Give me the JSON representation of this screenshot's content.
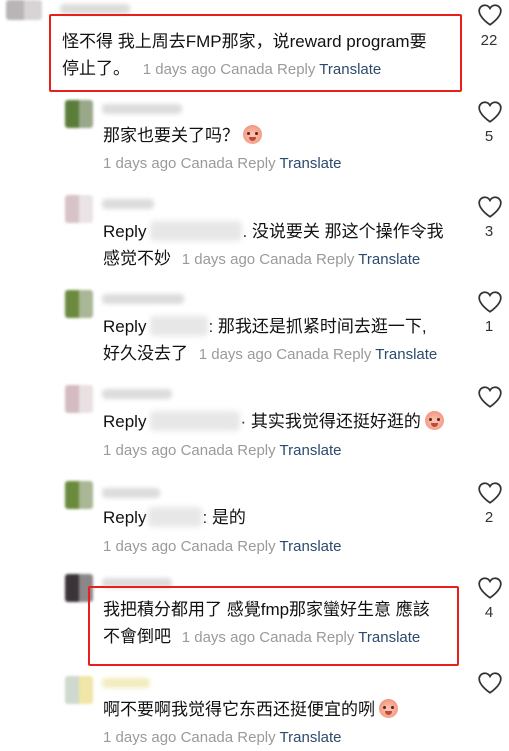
{
  "colors": {
    "highlight": "#e8201c",
    "translate_link": "#2d4a6e",
    "meta_gray": "#9a9a9a"
  },
  "comments": [
    {
      "text": "怪不得 我上周去FMP那家，说reward program要",
      "text2": "停止了。",
      "time": "1 days ago",
      "location": "Canada",
      "reply_label": "Reply",
      "translate_label": "Translate",
      "likes": "22",
      "highlighted": true,
      "avatar_colors": [
        "#b9b4b6",
        "#d8d4d6"
      ]
    },
    {
      "text": "那家也要关了吗？",
      "emoji": "crying-face-emoji",
      "time": "1 days ago",
      "location": "Canada",
      "reply_label": "Reply",
      "translate_label": "Translate",
      "likes": "5",
      "avatar_colors": [
        "#5b7d3a",
        "#9aa88a"
      ]
    },
    {
      "prefix": "Reply",
      "text": ". 没说要关 那这个操作令我",
      "text2": "感觉不妙",
      "time": "1 days ago",
      "location": "Canada",
      "reply_label": "Reply",
      "translate_label": "Translate",
      "likes": "3",
      "avatar_colors": [
        "#d8c3c7",
        "#ebe3e5"
      ]
    },
    {
      "prefix": "Reply",
      "text": ": 那我还是抓紧时间去逛一下,",
      "text2": "好久没去了",
      "time": "1 days ago",
      "location": "Canada",
      "reply_label": "Reply",
      "translate_label": "Translate",
      "likes": "1",
      "avatar_colors": [
        "#6b8a3e",
        "#a9b795"
      ]
    },
    {
      "prefix": "Reply",
      "text": "· 其实我觉得还挺好逛的",
      "emoji": "crying-face-emoji",
      "time": "1 days ago",
      "location": "Canada",
      "reply_label": "Reply",
      "translate_label": "Translate",
      "likes": "",
      "avatar_colors": [
        "#d4bcc1",
        "#e9e0e2"
      ]
    },
    {
      "prefix": "Reply",
      "text": ": 是的",
      "time": "1 days ago",
      "location": "Canada",
      "reply_label": "Reply",
      "translate_label": "Translate",
      "likes": "2",
      "avatar_colors": [
        "#6b8a3e",
        "#a9b795"
      ]
    },
    {
      "text": "我把積分都用了 感覺fmp那家蠻好生意 應該",
      "text2": "不會倒吧",
      "time": "1 days ago",
      "location": "Canada",
      "reply_label": "Reply",
      "translate_label": "Translate",
      "likes": "4",
      "highlighted": true,
      "avatar_colors": [
        "#3a3438",
        "#8d8689"
      ]
    },
    {
      "text": "啊不要啊我觉得它东西还挺便宜的咧",
      "emoji": "crying-face-emoji",
      "time": "1 days ago",
      "location": "Canada",
      "reply_label": "Reply",
      "translate_label": "Translate",
      "likes": "",
      "avatar_colors": [
        "#cfd9cf",
        "#f1e6a8"
      ]
    }
  ]
}
